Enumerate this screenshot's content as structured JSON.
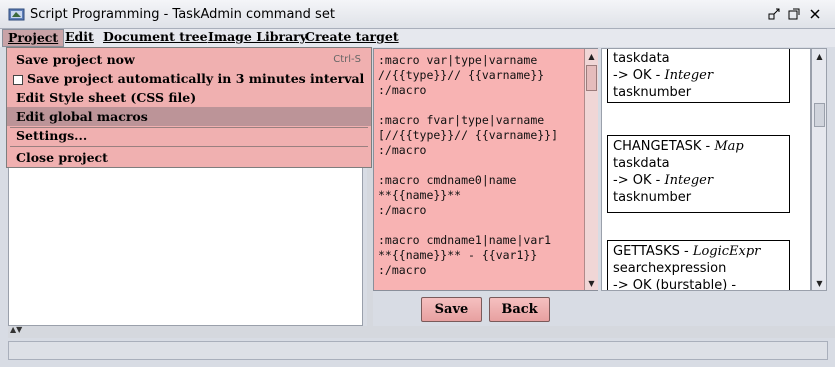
{
  "window": {
    "title": "Script Programming - TaskAdmin command set"
  },
  "menubar": {
    "items": [
      "Project",
      "Edit",
      "Document tree",
      "Image Library",
      "Create target"
    ]
  },
  "project_menu": {
    "save_now": "Save project now",
    "save_now_shortcut": "Ctrl-S",
    "auto_save": "Save project automatically in 3 minutes interval",
    "auto_save_checked": false,
    "edit_style": "Edit Style sheet (CSS file)",
    "edit_macros": "Edit global macros",
    "settings": "Settings...",
    "close": "Close project"
  },
  "editor": {
    "content": ":macro var|type|varname\n//{{type}}// {{varname}}\n:/macro\n\n:macro fvar|type|varname\n[//{{type}}// {{varname}}]\n:/macro\n\n:macro cmdname0|name\n**{{name}}**\n:/macro\n\n:macro cmdname1|name|var1\n**{{name}}** - {{var1}}\n:/macro"
  },
  "buttons": {
    "save": "Save",
    "back": "Back"
  },
  "preview": {
    "card1": {
      "line1": "taskdata",
      "arrow": "-> OK - ",
      "type": "Integer",
      "line3": "tasknumber"
    },
    "card2": {
      "name": "CHANGETASK - ",
      "kind": "Map",
      "line2": "taskdata",
      "arrow": "-> OK - ",
      "type": "Integer",
      "line4": "tasknumber"
    },
    "card3": {
      "name": "GETTASKS - ",
      "kind": "LogicExpr",
      "line2": "searchexpression",
      "line3": "-> OK (burstable) -"
    }
  },
  "colors": {
    "editor_bg": "#f8b3b3",
    "menu_bg": "#f0b0b0",
    "highlight": "#bc9498"
  }
}
